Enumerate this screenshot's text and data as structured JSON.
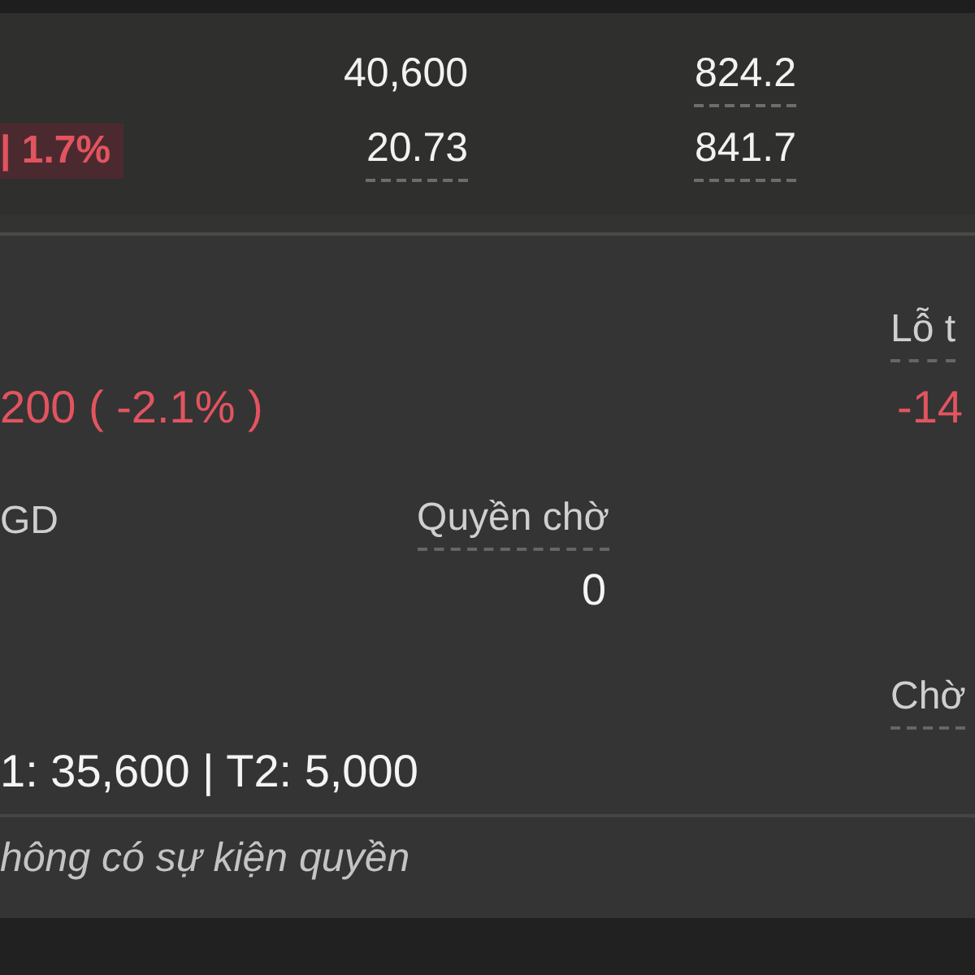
{
  "price_panel": {
    "change_badge": "| 1.7%",
    "rows": [
      {
        "values": [
          {
            "text": "40,600",
            "hint": false
          },
          {
            "text": "824.2",
            "hint": true
          }
        ]
      },
      {
        "values": [
          {
            "text": "20.73",
            "hint": true
          },
          {
            "text": "841.7",
            "hint": true
          }
        ]
      }
    ]
  },
  "position_panel": {
    "pnl_label": "Lỗ t",
    "change": "200 ( -2.1% )",
    "pnl_value": "-14",
    "trading_label": "GD",
    "pending_rights_label": "Quyền chờ",
    "pending_rights_value": "0",
    "waiting_label": "Chờ",
    "settlement": "1: 35,600 | T2: 5,000",
    "rights_note": "hông có sự kiện quyền"
  }
}
